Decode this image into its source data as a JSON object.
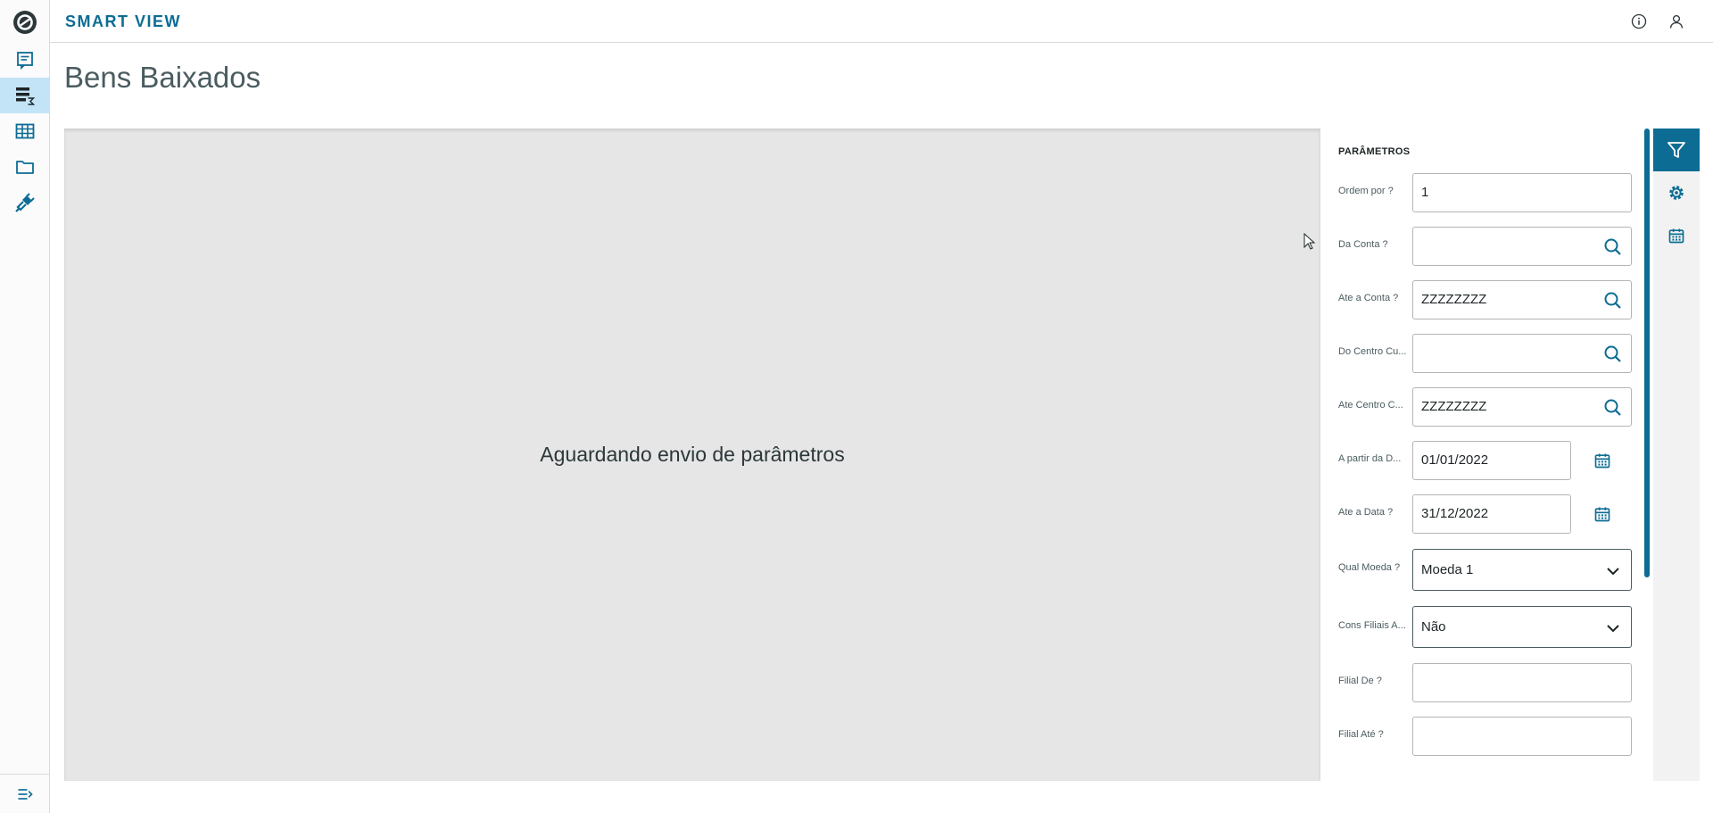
{
  "app": {
    "title": "SMART VIEW"
  },
  "page": {
    "title": "Bens Baixados"
  },
  "nav": {
    "items": [
      {
        "name": "reports-icon",
        "active": false
      },
      {
        "name": "data-analysis-icon",
        "active": true
      },
      {
        "name": "table-icon",
        "active": false
      },
      {
        "name": "folder-icon",
        "active": false
      },
      {
        "name": "plug-icon",
        "active": false
      }
    ]
  },
  "preview": {
    "message": "Aguardando envio de parâmetros"
  },
  "params": {
    "title": "PARÂMETROS",
    "fields": {
      "ordem": {
        "label": "Ordem por ?",
        "value": "1"
      },
      "da_conta": {
        "label": "Da Conta ?",
        "value": ""
      },
      "ate_conta": {
        "label": "Ate a Conta ?",
        "value": "ZZZZZZZZ"
      },
      "do_centro": {
        "label": "Do Centro Cu...",
        "value": ""
      },
      "ate_centro": {
        "label": "Ate Centro C...",
        "value": "ZZZZZZZZ"
      },
      "a_partir": {
        "label": "A partir da D...",
        "value": "01/01/2022"
      },
      "ate_data": {
        "label": "Ate a Data ?",
        "value": "31/12/2022"
      },
      "qual_moeda": {
        "label": "Qual Moeda ?",
        "value": "Moeda 1"
      },
      "cons_filiais": {
        "label": "Cons Filiais A...",
        "value": "Não"
      },
      "filial_de": {
        "label": "Filial De ?",
        "value": ""
      },
      "filial_ate": {
        "label": "Filial Até ?",
        "value": ""
      }
    }
  },
  "colors": {
    "brand": "#0c6c94",
    "preview_bg": "#e6e6e6",
    "nav_active": "#c3e4f7"
  }
}
